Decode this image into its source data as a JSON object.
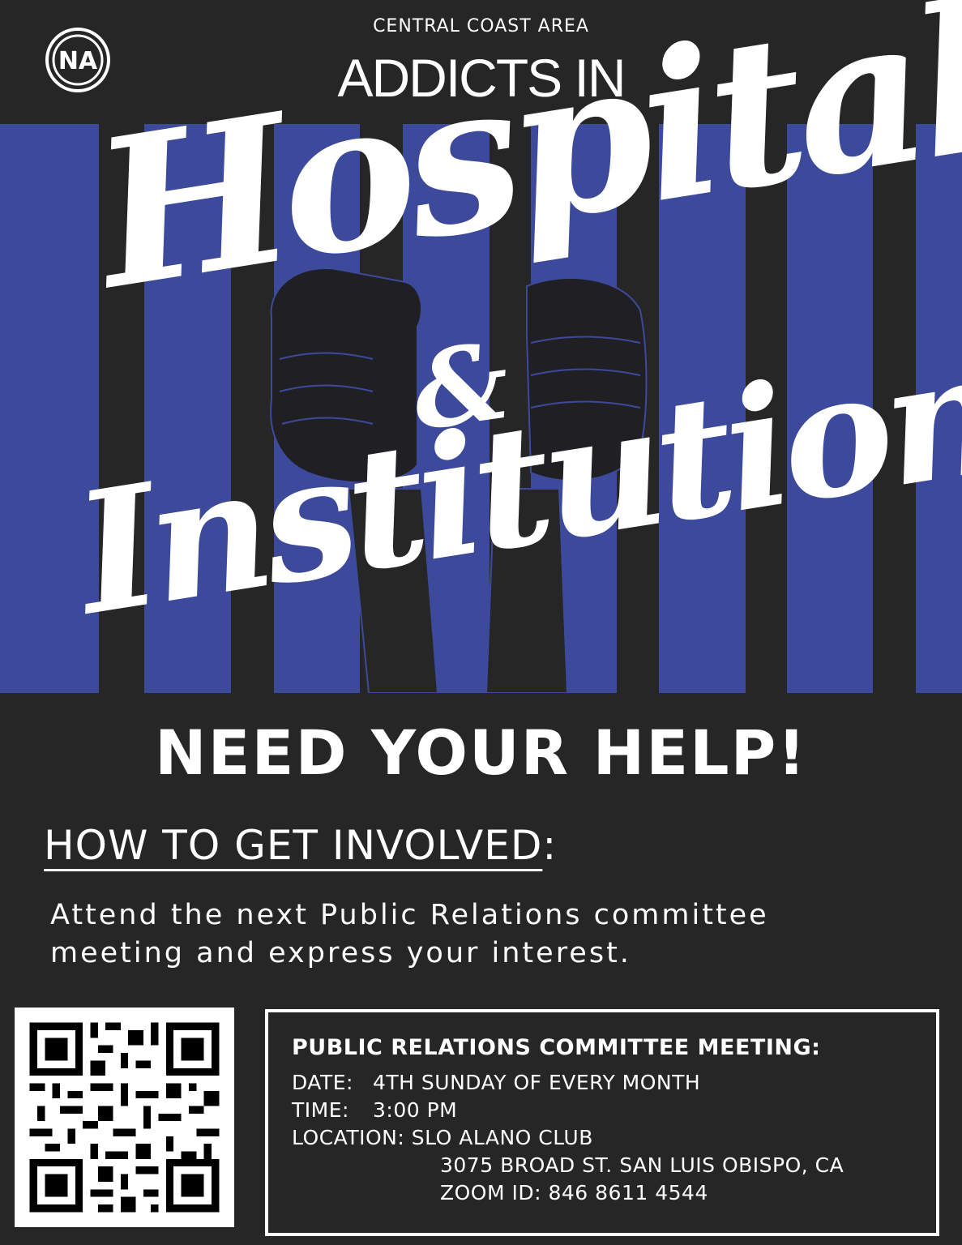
{
  "header": {
    "area": "CENTRAL COAST AREA",
    "headline_top": "ADDICTS IN",
    "logo": {
      "text": "NA",
      "icon": "na-logo-icon"
    }
  },
  "title": {
    "word1": "Hospitals",
    "ampersand": "&",
    "word2": "Institutions"
  },
  "colors": {
    "background": "#262626",
    "stripe_blue": "#3d4a9c",
    "text": "#ffffff"
  },
  "callout": "NEED YOUR HELP!",
  "involve": {
    "heading": "HOW TO GET INVOLVED",
    "colon": ":",
    "body_line1": "Attend the next Public Relations committee",
    "body_line2": "meeting and express your interest."
  },
  "meeting": {
    "title": "PUBLIC RELATIONS COMMITTEE MEETING:",
    "date_label": "DATE:",
    "date_value": "4TH SUNDAY OF EVERY MONTH",
    "time_label": "TIME:",
    "time_value": "3:00 PM",
    "location_label": "LOCATION:",
    "location_value": "SLO ALANO CLUB",
    "address": "3075 BROAD ST. SAN LUIS OBISPO, CA",
    "zoom": "ZOOM ID: 846 8611 4544"
  },
  "qr": {
    "icon": "qr-code-icon"
  }
}
